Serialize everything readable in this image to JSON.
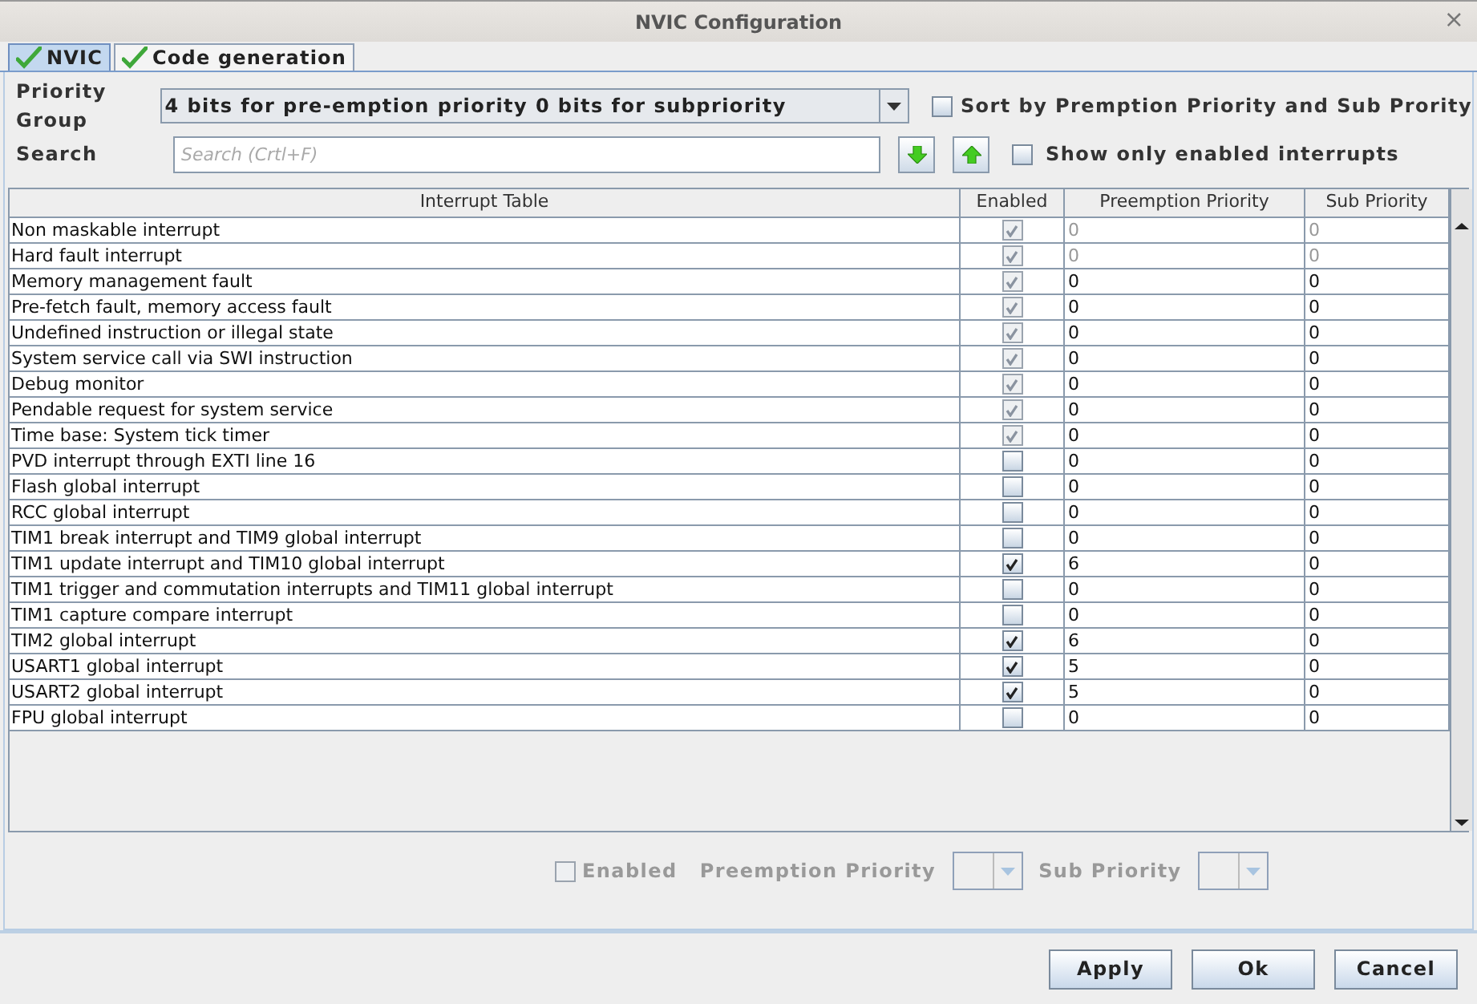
{
  "window": {
    "title": "NVIC Configuration",
    "close": "×"
  },
  "tabs": [
    {
      "label": "NVIC",
      "selected": true
    },
    {
      "label": "Code generation",
      "selected": false
    }
  ],
  "priority_group": {
    "label": "Priority Group",
    "value": "4 bits for pre-emption priority 0 bits for subpriority"
  },
  "sort_option": {
    "label": "Sort by Premption Priority and Sub Prority",
    "checked": false
  },
  "search": {
    "label": "Search",
    "placeholder": "Search (Crtl+F)"
  },
  "show_enabled_option": {
    "label": "Show only enabled interrupts",
    "checked": false
  },
  "table": {
    "columns": [
      "Interrupt Table",
      "Enabled",
      "Preemption Priority",
      "Sub Priority"
    ],
    "rows": [
      {
        "name": "Non maskable interrupt",
        "enabled": true,
        "disabled": true,
        "priority_disabled": true,
        "preemption": "0",
        "sub": "0"
      },
      {
        "name": "Hard fault interrupt",
        "enabled": true,
        "disabled": true,
        "priority_disabled": true,
        "preemption": "0",
        "sub": "0"
      },
      {
        "name": "Memory management fault",
        "enabled": true,
        "disabled": true,
        "priority_disabled": false,
        "preemption": "0",
        "sub": "0"
      },
      {
        "name": "Pre-fetch fault, memory access fault",
        "enabled": true,
        "disabled": true,
        "priority_disabled": false,
        "preemption": "0",
        "sub": "0"
      },
      {
        "name": "Undefined instruction or illegal state",
        "enabled": true,
        "disabled": true,
        "priority_disabled": false,
        "preemption": "0",
        "sub": "0"
      },
      {
        "name": "System service call via SWI instruction",
        "enabled": true,
        "disabled": true,
        "priority_disabled": false,
        "preemption": "0",
        "sub": "0"
      },
      {
        "name": "Debug monitor",
        "enabled": true,
        "disabled": true,
        "priority_disabled": false,
        "preemption": "0",
        "sub": "0"
      },
      {
        "name": "Pendable request for system service",
        "enabled": true,
        "disabled": true,
        "priority_disabled": false,
        "preemption": "0",
        "sub": "0"
      },
      {
        "name": "Time base: System tick timer",
        "enabled": true,
        "disabled": true,
        "priority_disabled": false,
        "preemption": "0",
        "sub": "0"
      },
      {
        "name": "PVD interrupt through EXTI line 16",
        "enabled": false,
        "disabled": false,
        "priority_disabled": false,
        "preemption": "0",
        "sub": "0"
      },
      {
        "name": "Flash global interrupt",
        "enabled": false,
        "disabled": false,
        "priority_disabled": false,
        "preemption": "0",
        "sub": "0"
      },
      {
        "name": "RCC global interrupt",
        "enabled": false,
        "disabled": false,
        "priority_disabled": false,
        "preemption": "0",
        "sub": "0"
      },
      {
        "name": "TIM1 break interrupt and TIM9 global interrupt",
        "enabled": false,
        "disabled": false,
        "priority_disabled": false,
        "preemption": "0",
        "sub": "0"
      },
      {
        "name": "TIM1 update interrupt and TIM10 global interrupt",
        "enabled": true,
        "disabled": false,
        "priority_disabled": false,
        "preemption": "6",
        "sub": "0"
      },
      {
        "name": "TIM1 trigger and commutation interrupts and TIM11 global interrupt",
        "enabled": false,
        "disabled": false,
        "priority_disabled": false,
        "preemption": "0",
        "sub": "0"
      },
      {
        "name": "TIM1 capture compare interrupt",
        "enabled": false,
        "disabled": false,
        "priority_disabled": false,
        "preemption": "0",
        "sub": "0"
      },
      {
        "name": "TIM2 global interrupt",
        "enabled": true,
        "disabled": false,
        "priority_disabled": false,
        "preemption": "6",
        "sub": "0"
      },
      {
        "name": "USART1 global interrupt",
        "enabled": true,
        "disabled": false,
        "priority_disabled": false,
        "preemption": "5",
        "sub": "0"
      },
      {
        "name": "USART2 global interrupt",
        "enabled": true,
        "disabled": false,
        "priority_disabled": false,
        "preemption": "5",
        "sub": "0"
      },
      {
        "name": "FPU global interrupt",
        "enabled": false,
        "disabled": false,
        "priority_disabled": false,
        "preemption": "0",
        "sub": "0"
      }
    ]
  },
  "editor": {
    "enabled": {
      "label": "Enabled",
      "checked": false
    },
    "preemption_label": "Preemption Priority",
    "sub_label": "Sub Priority",
    "disabled": true
  },
  "buttons": [
    "Apply",
    "Ok",
    "Cancel"
  ]
}
